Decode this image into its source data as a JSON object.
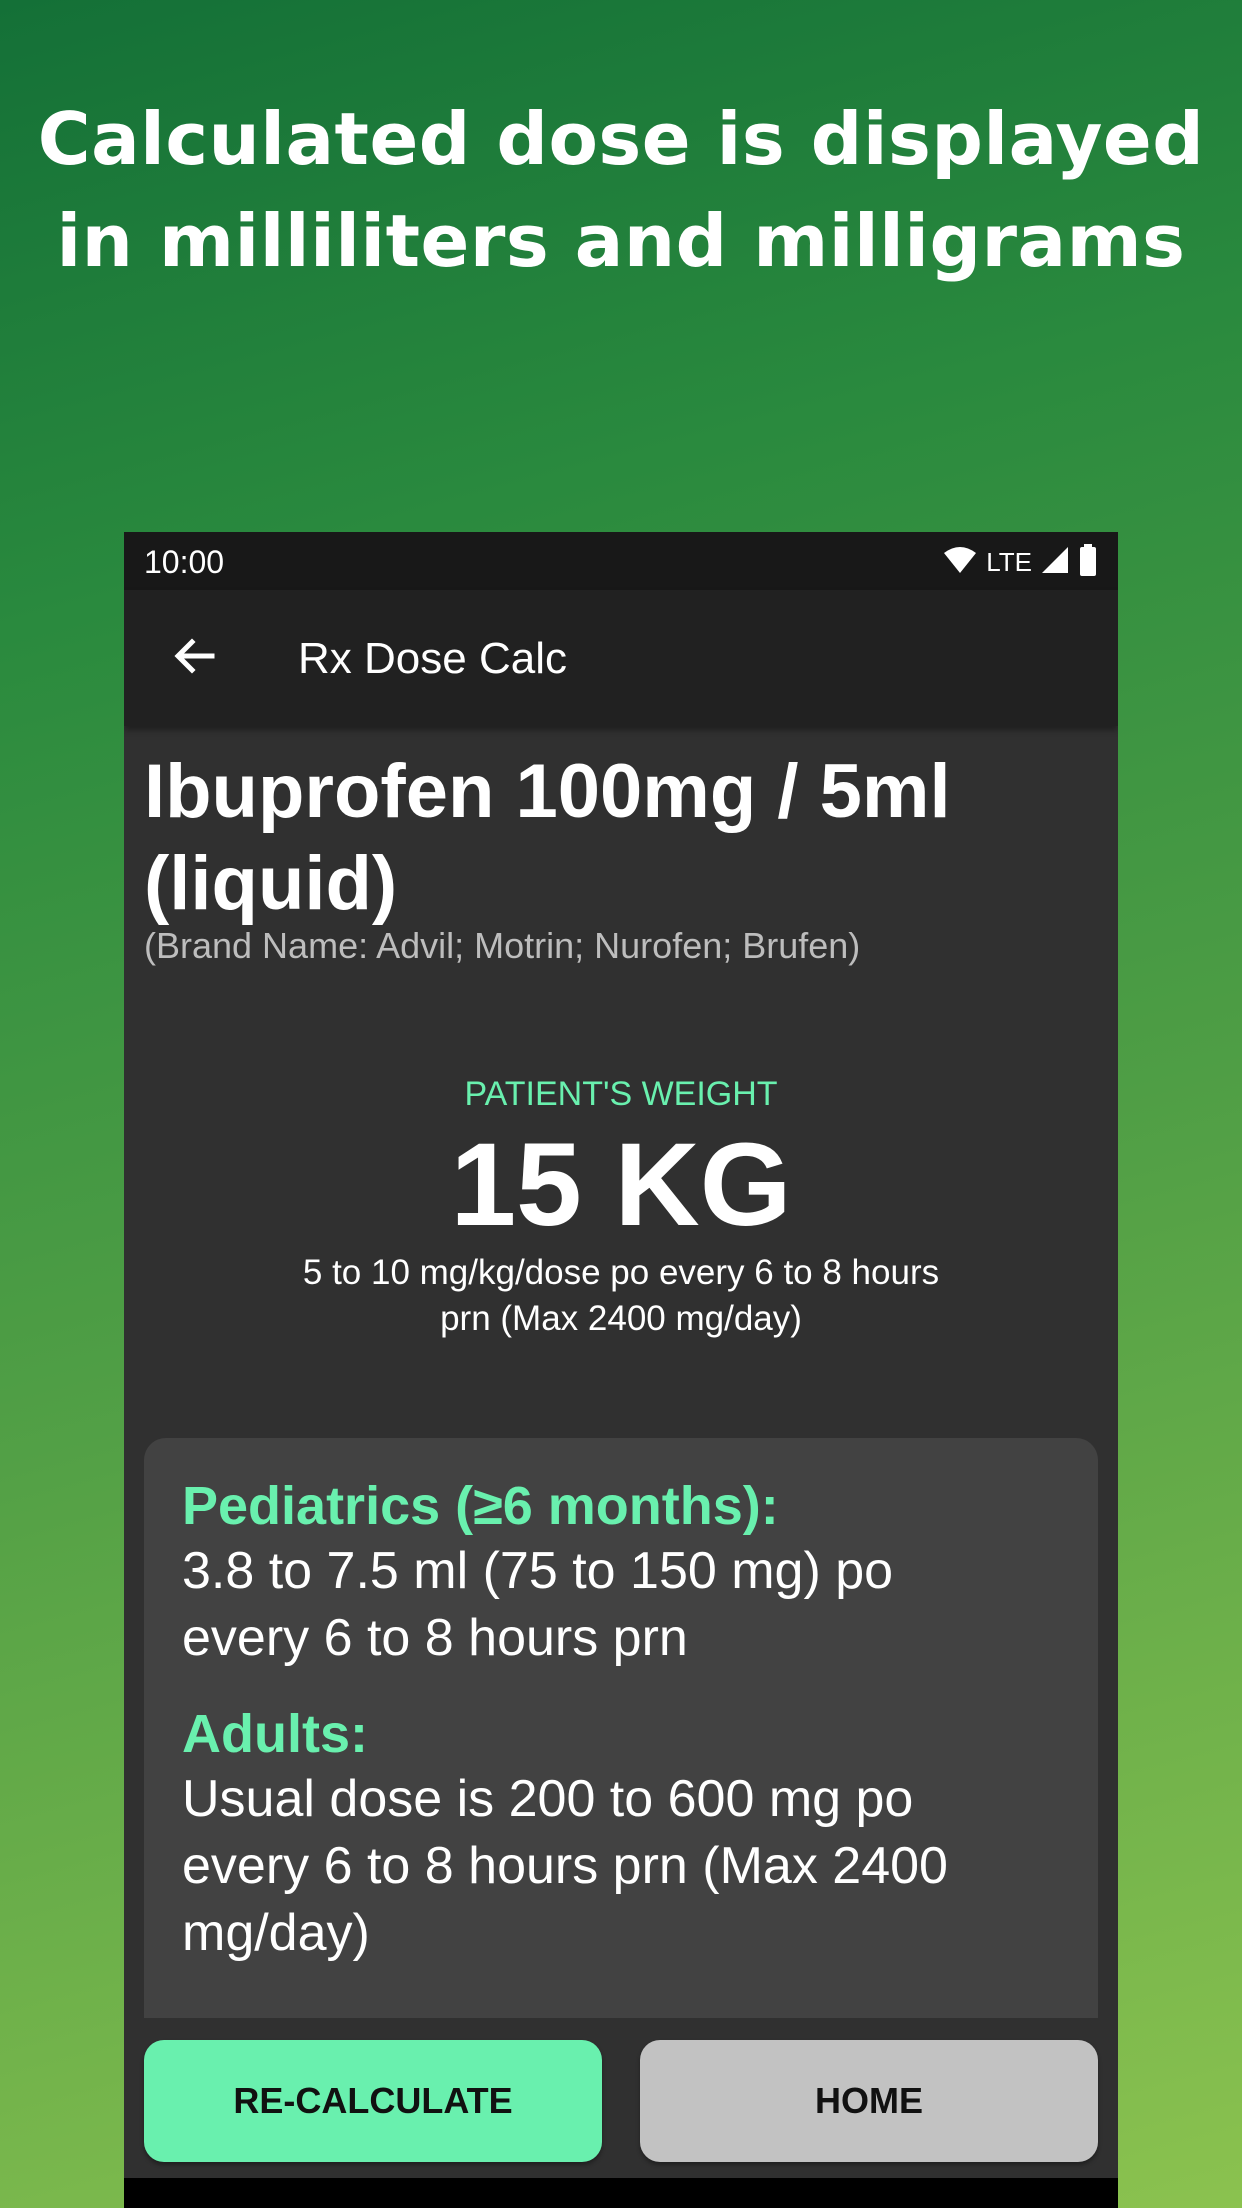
{
  "promo": {
    "headline_line1": "Calculated dose is displayed",
    "headline_line2": "in milliliters and milligrams"
  },
  "status_bar": {
    "time": "10:00",
    "network": "LTE",
    "icons": [
      "wifi-icon",
      "signal-icon",
      "battery-icon"
    ]
  },
  "app_bar": {
    "back_icon": "arrow-left-icon",
    "title": "Rx Dose Calc"
  },
  "drug": {
    "name_line1": "Ibuprofen 100mg / 5ml",
    "name_line2": "(liquid)",
    "brand_names": "(Brand Name: Advil; Motrin; Nurofen; Brufen)"
  },
  "patient": {
    "weight_label": "PATIENT'S WEIGHT",
    "weight_value": "15 KG",
    "dose_rule_line1": "5 to 10 mg/kg/dose po every 6 to 8 hours",
    "dose_rule_line2": "prn (Max 2400 mg/day)"
  },
  "results": [
    {
      "title": "Pediatrics (≥6 months):",
      "line1": "3.8 to 7.5 ml (75 to 150 mg) po",
      "line2": "every 6 to 8 hours prn"
    },
    {
      "title": "Adults:",
      "line1": "Usual dose is 200 to 600 mg po",
      "line2": "every 6 to 8 hours prn (Max 2400",
      "line3": "mg/day)"
    }
  ],
  "buttons": {
    "recalculate": "RE-CALCULATE",
    "home": "HOME"
  },
  "colors": {
    "accent": "#69f0ae",
    "background": "#303030",
    "card": "#424242",
    "app_bar": "#212121",
    "home_button": "#c2c2c2"
  }
}
